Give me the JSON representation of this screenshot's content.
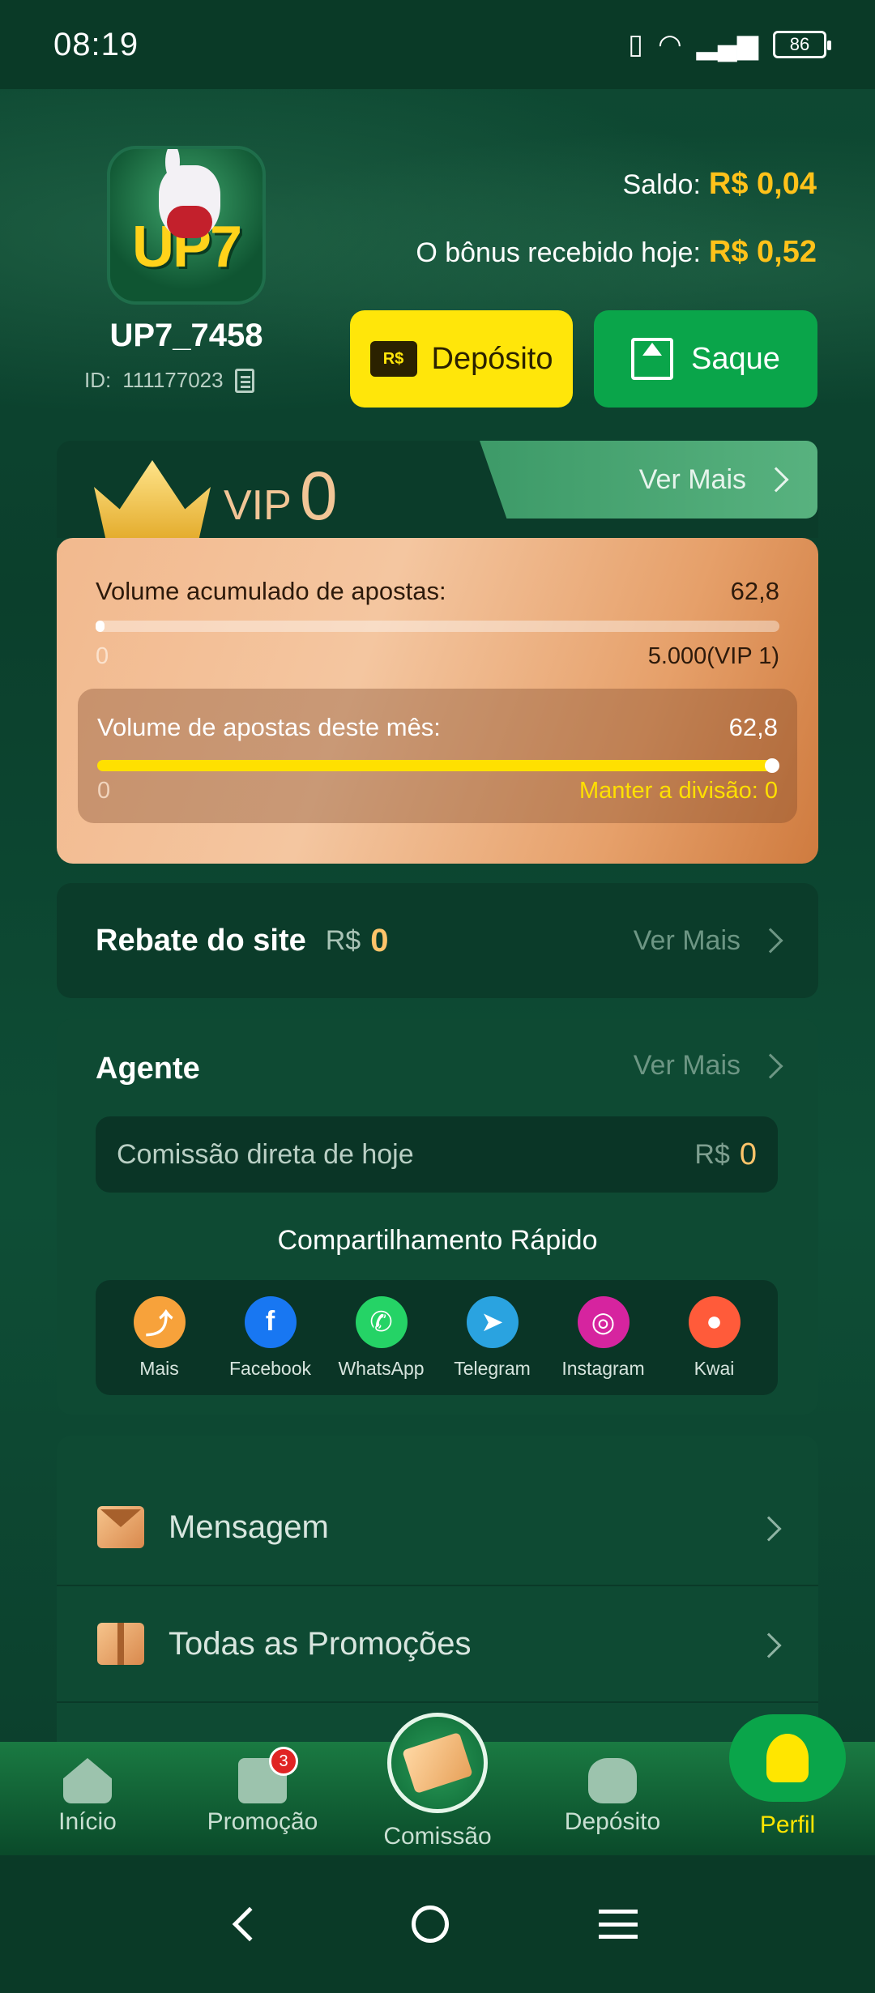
{
  "status": {
    "time": "08:19",
    "battery": "86"
  },
  "profile": {
    "username": "UP7_7458",
    "id_label": "ID:",
    "id_value": "111177023",
    "logo_text": "UP7"
  },
  "balance": {
    "saldo_label": "Saldo:",
    "saldo_value": "R$ 0,04",
    "bonus_label": "O bônus recebido hoje:",
    "bonus_value": "R$ 0,52"
  },
  "actions": {
    "deposit_label": "Depósito",
    "deposit_icon_text": "R$",
    "withdraw_label": "Saque"
  },
  "vip": {
    "label": "VIP",
    "level": "0",
    "ver_mais": "Ver Mais",
    "accumulated_label": "Volume acumulado de apostas:",
    "accumulated_value": "62,8",
    "accumulated_progress": 0.013,
    "accumulated_min": "0",
    "accumulated_target": "5.000(VIP 1)",
    "month_label": "Volume de apostas deste mês:",
    "month_value": "62,8",
    "month_progress": 1.0,
    "month_min": "0",
    "month_status": "Manter a divisão: 0"
  },
  "rebate": {
    "title": "Rebate do site",
    "currency": "R$",
    "value": "0",
    "ver_mais": "Ver Mais"
  },
  "agent": {
    "title": "Agente",
    "ver_mais": "Ver Mais",
    "commission_label": "Comissão direta de hoje",
    "commission_currency": "R$",
    "commission_value": "0",
    "share_title": "Compartilhamento Rápido",
    "share": [
      {
        "label": "Mais",
        "icon": "share-icon",
        "color": "#f7a23b"
      },
      {
        "label": "Facebook",
        "icon": "facebook-icon",
        "color": "#1877f2"
      },
      {
        "label": "WhatsApp",
        "icon": "whatsapp-icon",
        "color": "#25d366"
      },
      {
        "label": "Telegram",
        "icon": "telegram-icon",
        "color": "#2aa3e0"
      },
      {
        "label": "Instagram",
        "icon": "instagram-icon",
        "color": "#d6249f"
      },
      {
        "label": "Kwai",
        "icon": "kwai-icon",
        "color": "#ff5b3a"
      }
    ]
  },
  "menu": [
    {
      "label": "Mensagem",
      "icon": "mail-icon"
    },
    {
      "label": "Todas as Promoções",
      "icon": "gift-icon"
    }
  ],
  "nav": {
    "home": "Início",
    "promo": "Promoção",
    "promo_badge": "3",
    "commission": "Comissão",
    "deposit": "Depósito",
    "profile": "Perfil"
  },
  "colors": {
    "accent_yellow": "#ffe60a",
    "accent_green": "#0aa54a",
    "gold": "#ffc21a"
  }
}
